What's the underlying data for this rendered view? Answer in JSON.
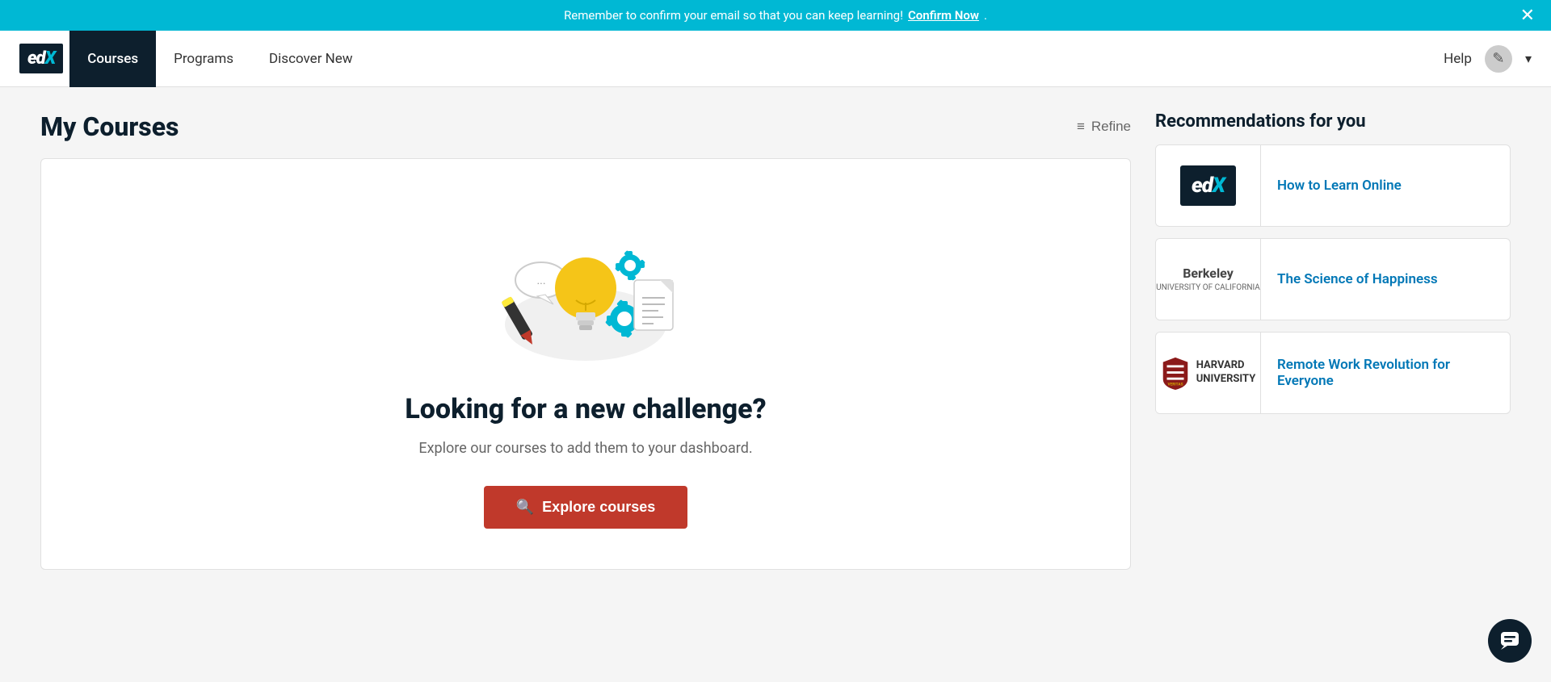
{
  "banner": {
    "message": "Remember to confirm your email so that you can keep learning!",
    "link_text": "Confirm Now",
    "suffix": "."
  },
  "navbar": {
    "logo_text": "edX",
    "items": [
      {
        "label": "Courses",
        "active": true
      },
      {
        "label": "Programs",
        "active": false
      },
      {
        "label": "Discover New",
        "active": false
      }
    ],
    "help_label": "Help"
  },
  "page": {
    "title": "My Courses",
    "refine_label": "Refine"
  },
  "main_card": {
    "challenge_title": "Looking for a new challenge?",
    "challenge_subtitle": "Explore our courses to add them to your dashboard.",
    "explore_btn_label": "Explore courses"
  },
  "recommendations": {
    "section_title": "Recommendations for you",
    "items": [
      {
        "id": "rec-edx",
        "logo_type": "edx",
        "title": "How to Learn Online"
      },
      {
        "id": "rec-berkeley",
        "logo_type": "berkeley",
        "title": "The Science of Happiness"
      },
      {
        "id": "rec-harvard",
        "logo_type": "harvard",
        "title": "Remote Work Revolution for Everyone"
      }
    ]
  }
}
